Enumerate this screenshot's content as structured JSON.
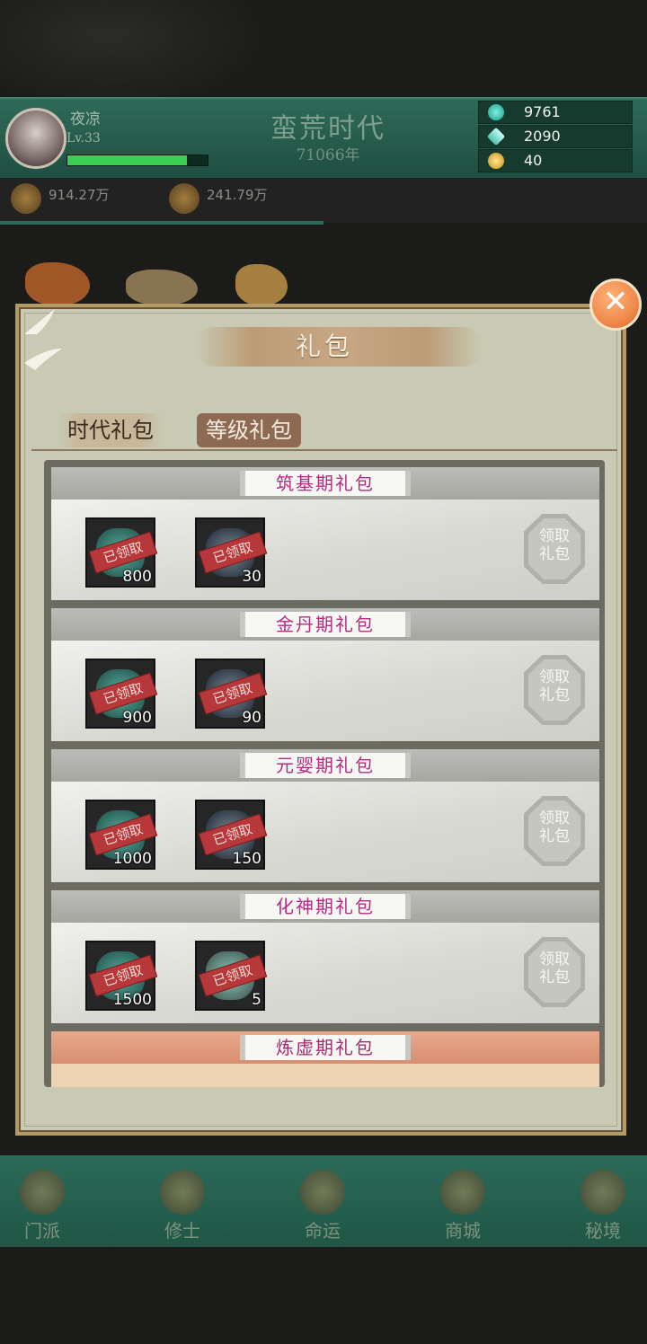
{
  "header": {
    "player_name": "夜凉",
    "player_level": "Lv.33",
    "exp_fraction": 0.85,
    "era_title": "蛮荒时代",
    "era_year": "71066年",
    "resources": [
      {
        "icon": "spirit-stone-icon",
        "value": "9761",
        "color": "#2fd0c0"
      },
      {
        "icon": "crystal-icon",
        "value": "2090",
        "color": "#7fe0d0"
      },
      {
        "icon": "gold-ingot-icon",
        "value": "40",
        "color": "#f0c040"
      }
    ],
    "stats": [
      {
        "icon": "disciple-icon",
        "value": "914.27万"
      },
      {
        "icon": "cultivator-icon",
        "value": "241.79万"
      }
    ]
  },
  "dialog": {
    "title": "礼包",
    "close_symbol": "✕",
    "tabs": [
      {
        "label": "时代礼包",
        "active": false
      },
      {
        "label": "等级礼包",
        "active": true
      }
    ],
    "packs": [
      {
        "title": "筑基期礼包",
        "items": [
          {
            "icon": "spirit-jade-icon",
            "stamp": "已领取",
            "qty": "800"
          },
          {
            "icon": "herb-icon",
            "stamp": "已领取",
            "qty": "30"
          }
        ],
        "button": "领取礼包"
      },
      {
        "title": "金丹期礼包",
        "items": [
          {
            "icon": "spirit-jade-icon",
            "stamp": "已领取",
            "qty": "900"
          },
          {
            "icon": "herb-icon",
            "stamp": "已领取",
            "qty": "90"
          }
        ],
        "button": "领取礼包"
      },
      {
        "title": "元婴期礼包",
        "items": [
          {
            "icon": "spirit-jade-icon",
            "stamp": "已领取",
            "qty": "1000"
          },
          {
            "icon": "herb-icon",
            "stamp": "已领取",
            "qty": "150"
          }
        ],
        "button": "领取礼包"
      },
      {
        "title": "化神期礼包",
        "items": [
          {
            "icon": "spirit-jade-icon",
            "stamp": "已领取",
            "qty": "1500"
          },
          {
            "icon": "bowl-icon",
            "stamp": "已领取",
            "qty": "5"
          }
        ],
        "button": "领取礼包"
      },
      {
        "title": "炼虚期礼包",
        "items": [],
        "button": ""
      }
    ]
  },
  "bottom_nav": [
    {
      "icon": "sect-icon",
      "label": "门派"
    },
    {
      "icon": "cultivator-nav-icon",
      "label": "修士"
    },
    {
      "icon": "fate-icon",
      "label": "命运"
    },
    {
      "icon": "shop-icon",
      "label": "商城"
    },
    {
      "icon": "secret-realm-icon",
      "label": "秘境"
    }
  ]
}
